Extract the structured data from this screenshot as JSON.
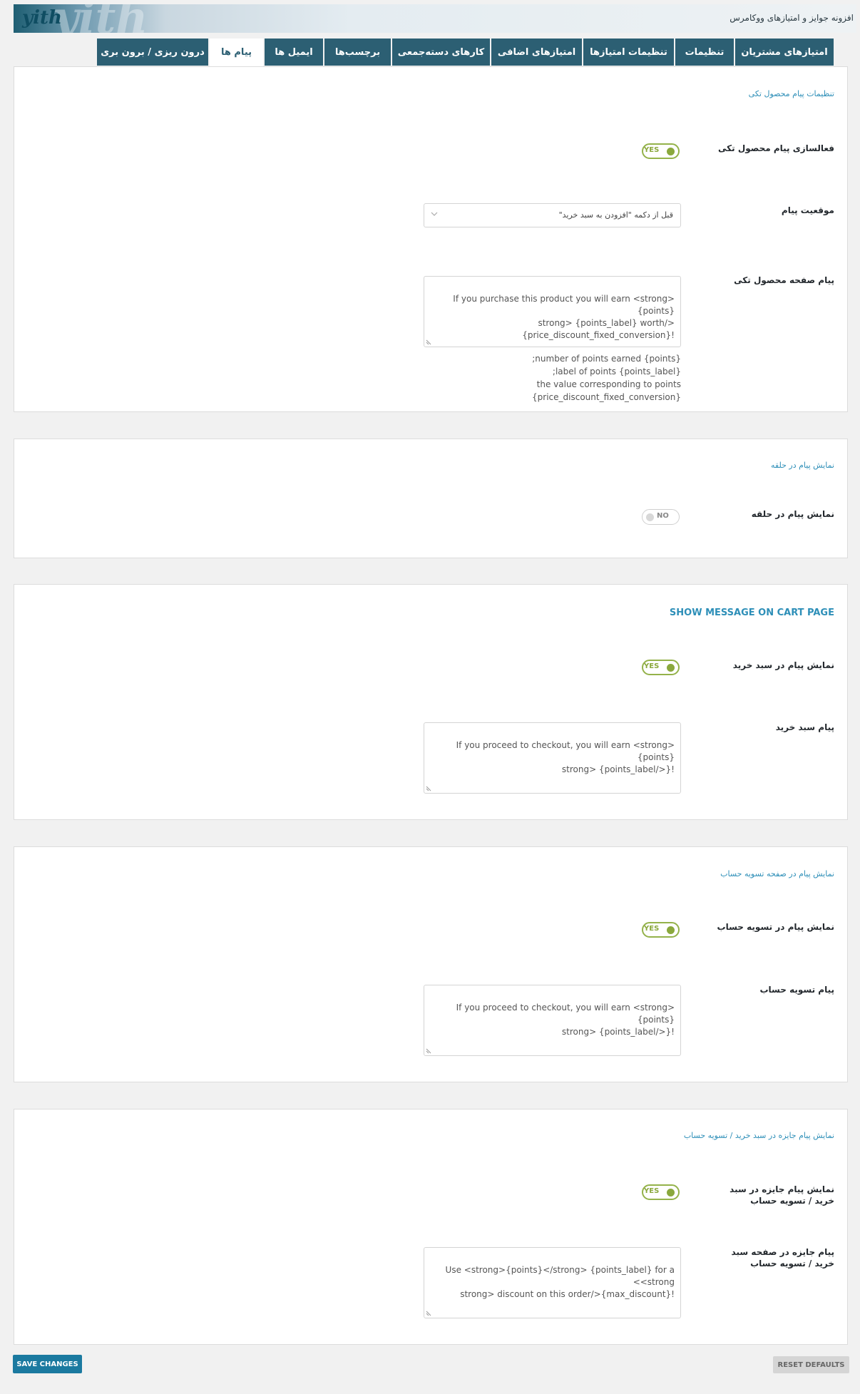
{
  "header": {
    "logo_text": "yith",
    "watermark": "yith",
    "title": "افزونه جوایز و امتیازهای ووکامرس"
  },
  "tabs": [
    {
      "label": "امتیازهای مشتریان",
      "active": false
    },
    {
      "label": "تنظیمات",
      "active": false
    },
    {
      "label": "تنظیمات امتیازها",
      "active": false
    },
    {
      "label": "امتیازهای اضافی",
      "active": false
    },
    {
      "label": "کارهای دسته‌جمعی",
      "active": false
    },
    {
      "label": "برچسب‌ها",
      "active": false
    },
    {
      "label": "ایمیل ها",
      "active": false
    },
    {
      "label": "پیام ها",
      "active": true
    },
    {
      "label": "درون ریزی / برون بری",
      "active": false
    }
  ],
  "sections": {
    "single_product": {
      "title": "تنظیمات پیام محصول تکی",
      "enable_label": "فعالسازی پیام محصول تکی",
      "enable_state": "YES",
      "position_label": "موقعیت پیام",
      "position_value": "قبل از دکمه \"افزودن به سبد خرید\"",
      "message_label": "پیام صفحه محصول تکی",
      "message_value": "If you purchase this product you will earn <strong>{points}\n</strong> {points_label} worth\n!{price_discount_fixed_conversion}",
      "description": "number of points earned {points};\nlabel of points {points_label};\nthe value corresponding to points {price_discount_fixed_conversion}"
    },
    "loop": {
      "title": "نمایش پیام در حلقه",
      "show_label": "نمایش پیام در حلقه",
      "show_state": "NO"
    },
    "cart": {
      "title": "SHOW MESSAGE ON CART PAGE",
      "show_label": "نمایش پیام در سبد خرید",
      "show_state": "YES",
      "message_label": "پیام سبد خرید",
      "message_value": "If you proceed to checkout, you will earn <strong>{points}\n!{</strong> {points_label"
    },
    "checkout": {
      "title": "نمایش پیام در صفحه تسویه حساب",
      "show_label": "نمایش پیام در تسویه حساب",
      "show_state": "YES",
      "message_label": "پیام تسویه حساب",
      "message_value": "If you proceed to checkout, you will earn <strong>{points}\n!{</strong> {points_label"
    },
    "reward": {
      "title": "نمایش پیام جایزه در سبد خرید / تسویه حساب",
      "show_label": "نمایش پیام جایزه در سبد خرید / تسویه حساب",
      "show_state": "YES",
      "message_label": "پیام جایزه در صفحه سبد خرید / تسویه حساب",
      "message_value": "Use <strong>{points}</strong> {points_label} for a <strong>\n!{max_discount}</strong> discount on this order"
    }
  },
  "footer": {
    "save_label": "SAVE CHANGES",
    "reset_label": "RESET DEFAULTS"
  }
}
